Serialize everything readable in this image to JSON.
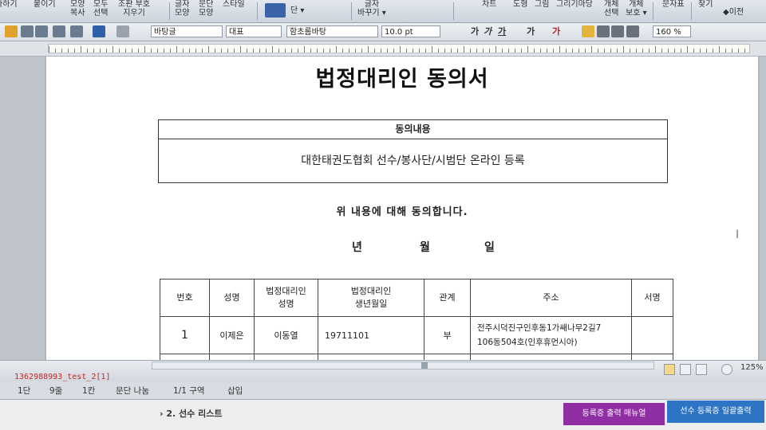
{
  "ribbon": {
    "items": [
      "사하기\n",
      "붙이기\n",
      "모양\n복사",
      "모두\n선택",
      "조판 부호\n지우기",
      "글자\n모양",
      "문단\n모양",
      "스타일\n",
      "단 ▾",
      "글자\n바꾸기 ▾",
      "차트\n",
      "도형",
      "그림",
      "그리기마당",
      "개체\n선택",
      "개체\n보호 ▾",
      "문자표\n",
      "찾기\n",
      "◆이전"
    ]
  },
  "toolbar": {
    "style_combo": "바탕글",
    "para_combo": "대표",
    "font_combo": "함초롬바탕",
    "size_combo": "10.0 pt",
    "format_glyphs": [
      "가",
      "가",
      "가",
      "가",
      "가"
    ],
    "zoom_combo": "160 %"
  },
  "document": {
    "title": "법정대리인 동의서",
    "consent_header": "동의내용",
    "consent_body": "대한태권도협회 선수/봉사단/시범단 온라인 등록",
    "agree_text": "위 내용에 대해 동의합니다.",
    "date_labels": [
      "년",
      "월",
      "일"
    ],
    "table_headers": [
      "번호",
      "성명",
      "법정대리인\n성명",
      "법정대리인\n생년월일",
      "관계",
      "주소",
      "서명"
    ],
    "rows": [
      {
        "no": "1",
        "name": "이제은",
        "rep_name": "이동열",
        "rep_birth": "19711101",
        "relation": "부",
        "address": "전주시덕진구인후동1가쌔나무2길7\n106동504호(인후휴먼시아)",
        "signature": ""
      }
    ]
  },
  "tabbar": {
    "doc_tab": "1362988993_test_2[1]",
    "zoom": "125%"
  },
  "status": {
    "items": [
      "1단",
      "9줄",
      "1칸",
      "문단 나눔",
      "1/1 구역",
      "삽입"
    ]
  },
  "web": {
    "breadcrumb": "› 2. 선수 리스트",
    "btn_manual": "등록증 출력 매뉴얼",
    "btn_bulk_print": "선수 등록증 일괄출력"
  }
}
